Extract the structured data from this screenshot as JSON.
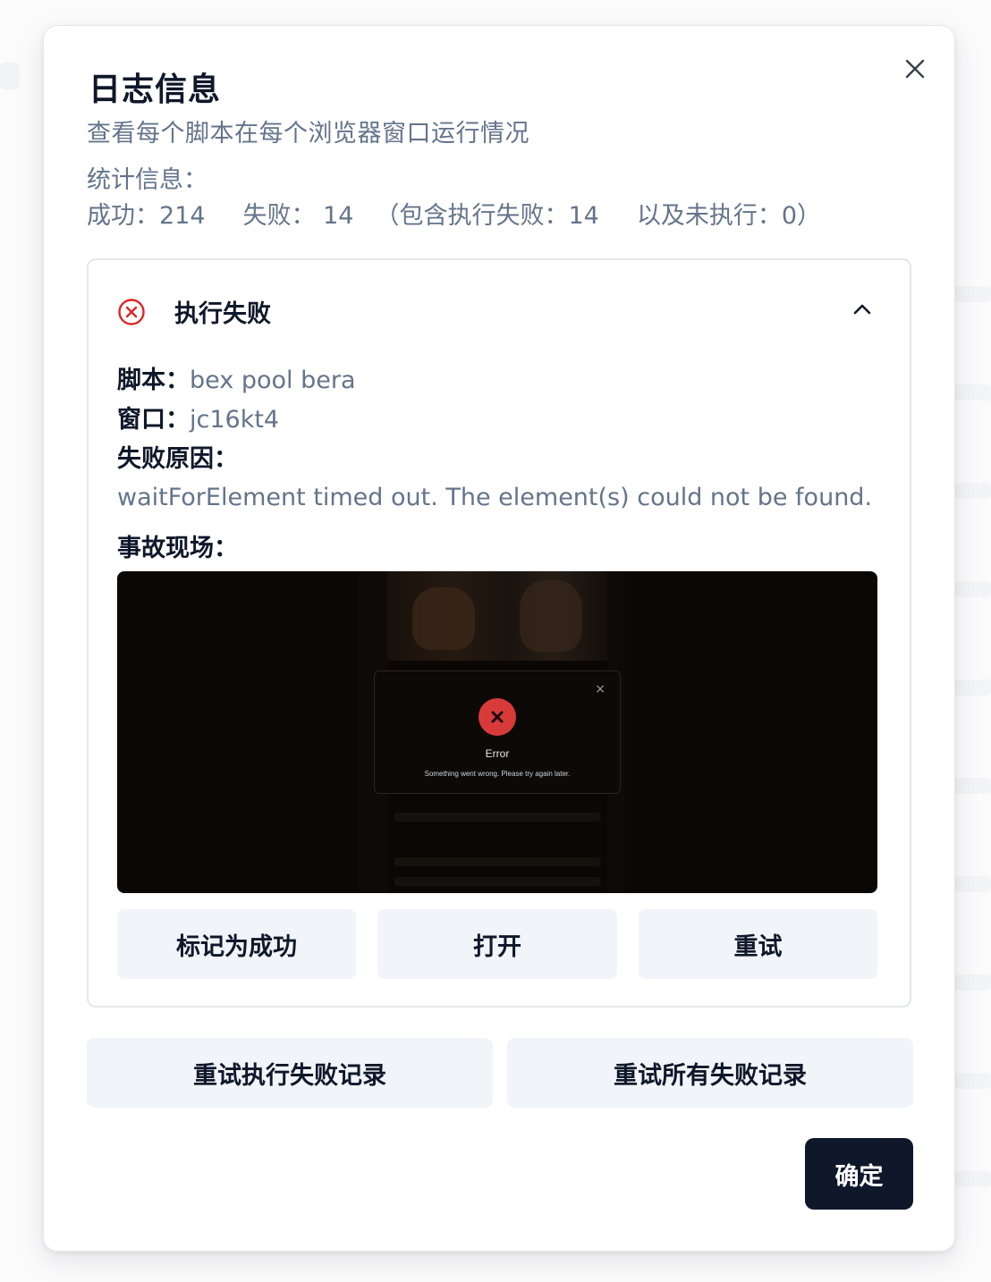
{
  "dialog": {
    "title": "日志信息",
    "subtitle": "查看每个脚本在每个浏览器窗口运行情况",
    "close_icon": "close-icon"
  },
  "stats": {
    "label": "统计信息：",
    "success": "成功：214",
    "failed": "失败： 14",
    "detail": "（包含执行失败：14",
    "not_executed": "以及未执行：0）"
  },
  "failure_card": {
    "status_icon": "error-circle-icon",
    "title": "执行失败",
    "collapse_icon": "chevron-up-icon",
    "script_label": "脚本：",
    "script_value": "bex pool bera",
    "window_label": "窗口：",
    "window_value": "jc16kt4",
    "reason_label": "失败原因：",
    "reason_text": "waitForElement timed out. The element(s) could not be found.",
    "scene_label": "事故现场：",
    "screenshot": {
      "modal_title": "Error",
      "modal_message": "Something went wrong. Please try again later.",
      "modal_close": "×"
    },
    "buttons": {
      "mark_success": "标记为成功",
      "open": "打开",
      "retry": "重试"
    }
  },
  "footer": {
    "retry_exec_failed": "重试执行失败记录",
    "retry_all_failed": "重试所有失败记录",
    "confirm": "确定"
  },
  "colors": {
    "primary_dark": "#0f172a",
    "muted_text": "#64748b",
    "button_bg": "#f1f5f9",
    "error_red": "#dc2626"
  }
}
